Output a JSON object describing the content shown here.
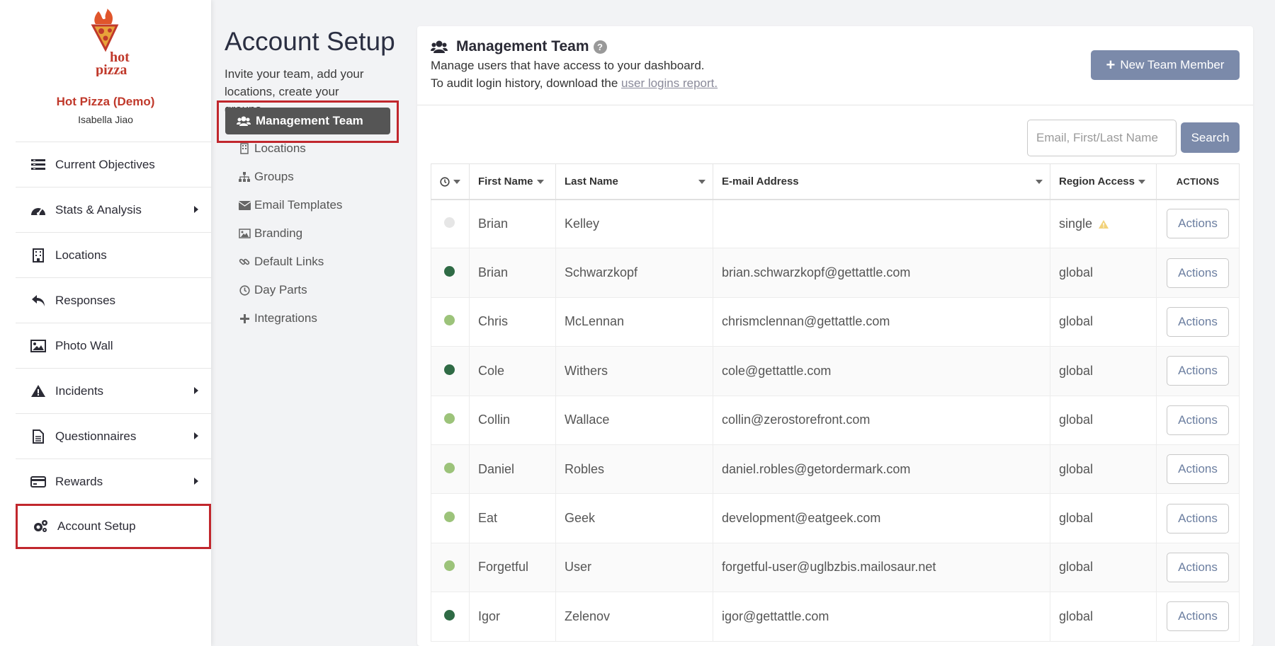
{
  "brand": {
    "name": "Hot Pizza (Demo)",
    "user": "Isabella Jiao",
    "logo_text": "hot pizza",
    "color": "#c0392b"
  },
  "sidebar": {
    "items": [
      {
        "label": "Current Objectives",
        "icon": "list-icon",
        "has_submenu": false,
        "active": false
      },
      {
        "label": "Stats & Analysis",
        "icon": "dashboard-gauge-icon",
        "has_submenu": true,
        "active": false
      },
      {
        "label": "Locations",
        "icon": "building-icon",
        "has_submenu": false,
        "active": false
      },
      {
        "label": "Responses",
        "icon": "reply-icon",
        "has_submenu": false,
        "active": false
      },
      {
        "label": "Photo Wall",
        "icon": "image-icon",
        "has_submenu": false,
        "active": false
      },
      {
        "label": "Incidents",
        "icon": "warning-icon",
        "has_submenu": true,
        "active": false
      },
      {
        "label": "Questionnaires",
        "icon": "document-icon",
        "has_submenu": true,
        "active": false
      },
      {
        "label": "Rewards",
        "icon": "credit-card-icon",
        "has_submenu": true,
        "active": false
      },
      {
        "label": "Account Setup",
        "icon": "cogs-icon",
        "has_submenu": false,
        "active": true
      }
    ]
  },
  "subnav": {
    "title": "Account Setup",
    "description": "Invite your team, add your locations, create your groups.",
    "active_item": "Management Team",
    "items": [
      {
        "label": "Locations",
        "icon": "building-icon"
      },
      {
        "label": "Groups",
        "icon": "sitemap-icon"
      },
      {
        "label": "Email Templates",
        "icon": "envelope-icon"
      },
      {
        "label": "Branding",
        "icon": "image-icon"
      },
      {
        "label": "Default Links",
        "icon": "link-icon"
      },
      {
        "label": "Day Parts",
        "icon": "clock-icon"
      },
      {
        "label": "Integrations",
        "icon": "plus-icon"
      }
    ]
  },
  "panel": {
    "title": "Management Team",
    "description_line1": "Manage users that have access to your dashboard.",
    "description_line2": "To audit login history, download the",
    "logins_link": "user logins report.",
    "new_member_button": "New Team Member",
    "search_placeholder": "Email, First/Last Name",
    "search_button": "Search"
  },
  "table": {
    "headers": {
      "first": "First Name",
      "last": "Last Name",
      "email": "E-mail Address",
      "region": "Region Access",
      "actions": "ACTIONS"
    },
    "status_colors": {
      "inactive": "#e6e6e6",
      "active_dark": "#2f6b45",
      "active_light": "#9cc37a"
    },
    "rows": [
      {
        "status": "inactive",
        "first": "Brian",
        "last": "Kelley",
        "email": "",
        "region": "single",
        "warning": true,
        "action": "Actions"
      },
      {
        "status": "active_dark",
        "first": "Brian",
        "last": "Schwarzkopf",
        "email": "brian.schwarzkopf@gettattle.com",
        "region": "global",
        "warning": false,
        "action": "Actions"
      },
      {
        "status": "active_light",
        "first": "Chris",
        "last": "McLennan",
        "email": "chrismclennan@gettattle.com",
        "region": "global",
        "warning": false,
        "action": "Actions"
      },
      {
        "status": "active_dark",
        "first": "Cole",
        "last": "Withers",
        "email": "cole@gettattle.com",
        "region": "global",
        "warning": false,
        "action": "Actions"
      },
      {
        "status": "active_light",
        "first": "Collin",
        "last": "Wallace",
        "email": "collin@zerostorefront.com",
        "region": "global",
        "warning": false,
        "action": "Actions"
      },
      {
        "status": "active_light",
        "first": "Daniel",
        "last": "Robles",
        "email": "daniel.robles@getordermark.com",
        "region": "global",
        "warning": false,
        "action": "Actions"
      },
      {
        "status": "active_light",
        "first": "Eat",
        "last": "Geek",
        "email": "development@eatgeek.com",
        "region": "global",
        "warning": false,
        "action": "Actions"
      },
      {
        "status": "active_light",
        "first": "Forgetful",
        "last": "User",
        "email": "forgetful-user@uglbzbis.mailosaur.net",
        "region": "global",
        "warning": false,
        "action": "Actions"
      },
      {
        "status": "active_dark",
        "first": "Igor",
        "last": "Zelenov",
        "email": "igor@gettattle.com",
        "region": "global",
        "warning": false,
        "action": "Actions"
      }
    ]
  }
}
